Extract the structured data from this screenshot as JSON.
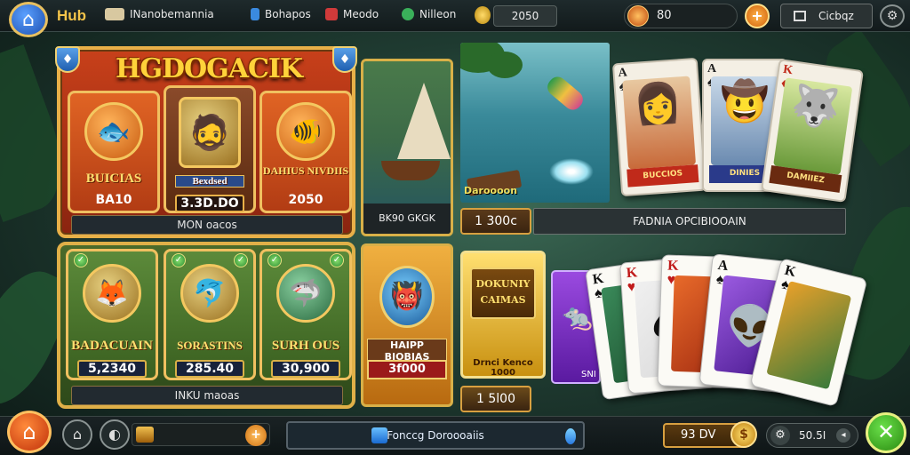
{
  "topbar": {
    "hub_label": "Hub",
    "items": [
      {
        "label": "INanobemannia",
        "icon": "mask-icon",
        "color": "#d8c8a0"
      },
      {
        "label": "Bohapos",
        "icon": "flag-icon",
        "color": "#3a8ae0"
      },
      {
        "label": "Meodo",
        "icon": "dragon-icon",
        "color": "#d03a3a"
      },
      {
        "label": "Nilleon",
        "icon": "orb-icon",
        "color": "#3ab05a"
      }
    ],
    "coins": "2050",
    "gems": "80",
    "grid_button_label": "Cicbqz"
  },
  "featured_panel": {
    "title": "HGDOGACIK",
    "slots": [
      {
        "name": "BUICIAS",
        "value": "BA10"
      },
      {
        "name": "Bexdsed",
        "value": "3.3D.DO"
      },
      {
        "name": "DAHIUS NIVDIIS",
        "value": "2050"
      }
    ],
    "footer": "MON oacos"
  },
  "second_panel": {
    "slots": [
      {
        "name": "BADACUAIN",
        "value": "5,2340"
      },
      {
        "name": "SORASTINS",
        "value": "285.40"
      },
      {
        "name": "SURH OUS",
        "value": "30,900"
      }
    ],
    "footer": "INKU maoas"
  },
  "boat_card": {
    "caption": "BK90 GKGK"
  },
  "mask_card": {
    "name": "HAIPP BIOBIAS",
    "value": "3f000"
  },
  "water_scene": {
    "caption": "Daroooon"
  },
  "water_stat": "1 300c",
  "wide_bar": "FADNIA OPCIBIOOAIN",
  "character_cards": [
    {
      "rank": "A",
      "suit": "♠",
      "caption": "BUCCIOS"
    },
    {
      "rank": "A",
      "suit": "♠",
      "caption": "DINIES"
    },
    {
      "rank": "K",
      "suit": "♦",
      "caption": "DAMIIEZ"
    }
  ],
  "gold_card": {
    "plate": "DOKUNIY CAIMAS",
    "caption": "Drnci Kenco 1000"
  },
  "gold_stat": "1 5l00",
  "purple_card": {
    "caption": "SNI"
  },
  "play_cards": [
    {
      "rank": "K",
      "suit": "♠"
    },
    {
      "rank": "K",
      "suit": "♥"
    },
    {
      "rank": "K",
      "suit": "♥"
    },
    {
      "rank": "A",
      "suit": "♠"
    },
    {
      "rank": "K",
      "suit": "♠"
    }
  ],
  "bottombar": {
    "center_label": "Fonccg Doroooaiis",
    "value": "93 DV",
    "stat": "50.5I"
  },
  "colors": {
    "accent_gold": "#e8b048",
    "panel_orange": "#c8401a",
    "panel_green": "#4a6a2a",
    "confirm_green": "#3aa01a"
  }
}
